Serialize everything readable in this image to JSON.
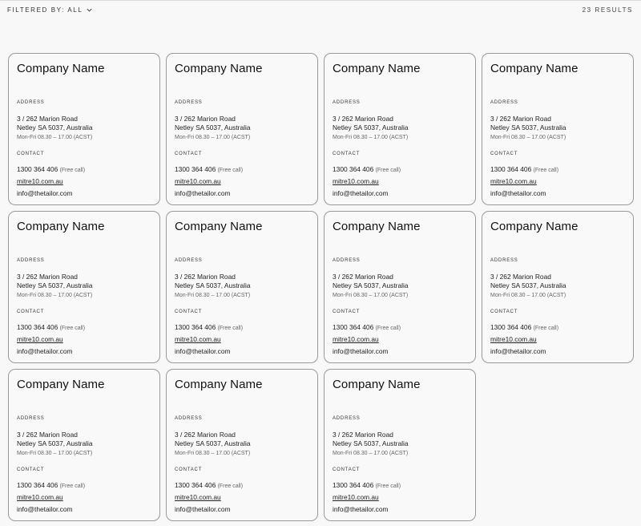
{
  "toolbar": {
    "filter_label": "FILTERED BY: ALL",
    "results_label": "23 RESULTS"
  },
  "cards": [
    {
      "name": "Company Name",
      "address_label": "ADDRESS",
      "address_line1": "3 / 262 Marion Road",
      "address_line2": "Netley SA 5037, Australia",
      "hours": "Mon-Fri 08.30 – 17.00 (ACST)",
      "contact_label": "CONTACT",
      "phone": "1300 364 406",
      "phone_note": "(Free call)",
      "website": "mitre10.com.au",
      "email": "info@thetailor.com"
    },
    {
      "name": "Company Name",
      "address_label": "ADDRESS",
      "address_line1": "3 / 262 Marion Road",
      "address_line2": "Netley SA 5037, Australia",
      "hours": "Mon-Fri 08.30 – 17.00 (ACST)",
      "contact_label": "CONTACT",
      "phone": "1300 364 406",
      "phone_note": "(Free call)",
      "website": "mitre10.com.au",
      "email": "info@thetailor.com"
    },
    {
      "name": "Company Name",
      "address_label": "ADDRESS",
      "address_line1": "3 / 262 Marion Road",
      "address_line2": "Netley SA 5037, Australia",
      "hours": "Mon-Fri 08.30 – 17.00 (ACST)",
      "contact_label": "CONTACT",
      "phone": "1300 364 406",
      "phone_note": "(Free call)",
      "website": "mitre10.com.au",
      "email": "info@thetailor.com"
    },
    {
      "name": "Company Name",
      "address_label": "ADDRESS",
      "address_line1": "3 / 262 Marion Road",
      "address_line2": "Netley SA 5037, Australia",
      "hours": "Mon-Fri 08.30 – 17.00 (ACST)",
      "contact_label": "CONTACT",
      "phone": "1300 364 406",
      "phone_note": "(Free call)",
      "website": "mitre10.com.au",
      "email": "info@thetailor.com"
    },
    {
      "name": "Company Name",
      "address_label": "ADDRESS",
      "address_line1": "3 / 262 Marion Road",
      "address_line2": "Netley SA 5037, Australia",
      "hours": "Mon-Fri 08.30 – 17.00 (ACST)",
      "contact_label": "CONTACT",
      "phone": "1300 364 406",
      "phone_note": "(Free call)",
      "website": "mitre10.com.au",
      "email": "info@thetailor.com"
    },
    {
      "name": "Company Name",
      "address_label": "ADDRESS",
      "address_line1": "3 / 262 Marion Road",
      "address_line2": "Netley SA 5037, Australia",
      "hours": "Mon-Fri 08.30 – 17.00 (ACST)",
      "contact_label": "CONTACT",
      "phone": "1300 364 406",
      "phone_note": "(Free call)",
      "website": "mitre10.com.au",
      "email": "info@thetailor.com"
    },
    {
      "name": "Company Name",
      "address_label": "ADDRESS",
      "address_line1": "3 / 262 Marion Road",
      "address_line2": "Netley SA 5037, Australia",
      "hours": "Mon-Fri 08.30 – 17.00 (ACST)",
      "contact_label": "CONTACT",
      "phone": "1300 364 406",
      "phone_note": "(Free call)",
      "website": "mitre10.com.au",
      "email": "info@thetailor.com"
    },
    {
      "name": "Company Name",
      "address_label": "ADDRESS",
      "address_line1": "3 / 262 Marion Road",
      "address_line2": "Netley SA 5037, Australia",
      "hours": "Mon-Fri 08.30 – 17.00 (ACST)",
      "contact_label": "CONTACT",
      "phone": "1300 364 406",
      "phone_note": "(Free call)",
      "website": "mitre10.com.au",
      "email": "info@thetailor.com"
    },
    {
      "name": "Company Name",
      "address_label": "ADDRESS",
      "address_line1": "3 / 262 Marion Road",
      "address_line2": "Netley SA 5037, Australia",
      "hours": "Mon-Fri 08.30 – 17.00 (ACST)",
      "contact_label": "CONTACT",
      "phone": "1300 364 406",
      "phone_note": "(Free call)",
      "website": "mitre10.com.au",
      "email": "info@thetailor.com"
    },
    {
      "name": "Company Name",
      "address_label": "ADDRESS",
      "address_line1": "3 / 262 Marion Road",
      "address_line2": "Netley SA 5037, Australia",
      "hours": "Mon-Fri 08.30 – 17.00 (ACST)",
      "contact_label": "CONTACT",
      "phone": "1300 364 406",
      "phone_note": "(Free call)",
      "website": "mitre10.com.au",
      "email": "info@thetailor.com"
    },
    {
      "name": "Company Name",
      "address_label": "ADDRESS",
      "address_line1": "3 / 262 Marion Road",
      "address_line2": "Netley SA 5037, Australia",
      "hours": "Mon-Fri 08.30 – 17.00 (ACST)",
      "contact_label": "CONTACT",
      "phone": "1300 364 406",
      "phone_note": "(Free call)",
      "website": "mitre10.com.au",
      "email": "info@thetailor.com"
    }
  ]
}
